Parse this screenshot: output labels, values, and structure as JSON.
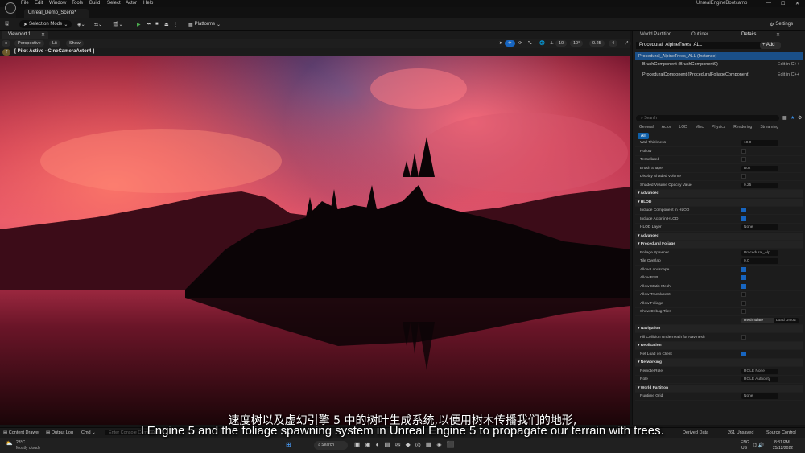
{
  "menubar": {
    "items": [
      "File",
      "Edit",
      "Window",
      "Tools",
      "Build",
      "Select",
      "Actor",
      "Help"
    ],
    "project_name": "UnrealEngineBootcamp",
    "scene_tab": "Unreal_Demo_Scene*"
  },
  "toolbar": {
    "selection_mode": "Selection Mode",
    "platforms": "Platforms",
    "settings": "Settings"
  },
  "viewport": {
    "tab": "Viewport 1",
    "perspective": "Perspective",
    "lit": "Lit",
    "show": "Show",
    "pilot_label": "[ Pilot Active - CineCameraActor4 ]",
    "grid_snap": "10",
    "rot_snap": "10°",
    "scale_snap": "0.25",
    "camera_speed": "4"
  },
  "panel": {
    "tabs": [
      "World Partition",
      "Outliner",
      "Details"
    ],
    "actor_name": "Procedural_AlpineTrees_ALL",
    "add_label": "+ Add",
    "instance_row": "Procedural_AlpineTrees_ALL (Instance)",
    "components": [
      {
        "label": "BrushComponent (BrushComponent0)",
        "action": "Edit in C++"
      },
      {
        "label": "ProceduralComponent (ProceduralFoliageComponent)",
        "action": "Edit in C++"
      }
    ],
    "search_placeholder": "Search",
    "categories": [
      "General",
      "Actor",
      "LOD",
      "Misc",
      "Physics",
      "Rendering",
      "Streaming",
      "All"
    ],
    "properties": [
      {
        "label": "Wall Thickness",
        "type": "field",
        "value": "10.0"
      },
      {
        "label": "Hollow",
        "type": "check",
        "value": false
      },
      {
        "label": "Tessellated",
        "type": "check",
        "value": false
      },
      {
        "label": "Brush Shape",
        "type": "field",
        "value": "Box"
      },
      {
        "label": "Display Shaded Volume",
        "type": "check",
        "value": false
      },
      {
        "label": "Shaded Volume Opacity Value",
        "type": "field",
        "value": "0.25"
      },
      {
        "label": "Advanced",
        "type": "sect"
      },
      {
        "label": "HLOD",
        "type": "sect"
      },
      {
        "label": "Include Component in HLOD",
        "type": "check",
        "value": true
      },
      {
        "label": "Include Actor in HLOD",
        "type": "check",
        "value": true
      },
      {
        "label": "HLOD Layer",
        "type": "field",
        "value": "None"
      },
      {
        "label": "Advanced",
        "type": "sect"
      },
      {
        "label": "Procedural Foliage",
        "type": "sect"
      },
      {
        "label": "Foliage Spawner",
        "type": "field",
        "value": "Procedural_Alp"
      },
      {
        "label": "Tile Overlap",
        "type": "field",
        "value": "0.0"
      },
      {
        "label": "Allow Landscape",
        "type": "check",
        "value": true
      },
      {
        "label": "Allow BSP",
        "type": "check",
        "value": true
      },
      {
        "label": "Allow Static Mesh",
        "type": "check",
        "value": true
      },
      {
        "label": "Allow Translucent",
        "type": "check",
        "value": false
      },
      {
        "label": "Allow Foliage",
        "type": "check",
        "value": false
      },
      {
        "label": "Show Debug Tiles",
        "type": "check",
        "value": false
      },
      {
        "label": "",
        "type": "buttons",
        "value": "Resimulate",
        "value2": "Load Unloa"
      },
      {
        "label": "Navigation",
        "type": "sect"
      },
      {
        "label": "Fill Collision Underneath for Navmesh",
        "type": "check",
        "value": false
      },
      {
        "label": "Replication",
        "type": "sect"
      },
      {
        "label": "Net Load on Client",
        "type": "check",
        "value": true
      },
      {
        "label": "Networking",
        "type": "sect"
      },
      {
        "label": "Remote Role",
        "type": "field",
        "value": "ROLE None"
      },
      {
        "label": "Role",
        "type": "field",
        "value": "ROLE Authority"
      },
      {
        "label": "World Partition",
        "type": "sect"
      },
      {
        "label": "Runtime Grid",
        "type": "field",
        "value": "None"
      }
    ]
  },
  "bottombar": {
    "content_drawer": "Content Drawer",
    "output_log": "Output Log",
    "cmd": "Cmd",
    "console_placeholder": "Enter Console Command",
    "derived_data": "Derived Data",
    "unsaved": "261 Unsaved",
    "source_control": "Source Control"
  },
  "taskbar": {
    "weather_temp": "23°C",
    "weather_desc": "Mostly cloudy",
    "search": "Search",
    "lang": "ENG",
    "region": "US",
    "time": "8:31 PM",
    "date": "25/12/2022"
  },
  "subtitles": {
    "zh": "速度树以及虚幻引擎 5 中的树叶生成系统,以便用树木传播我们的地形,",
    "en": "l Engine 5 and the foliage spawning system in Unreal Engine 5 to propagate our terrain with trees."
  }
}
